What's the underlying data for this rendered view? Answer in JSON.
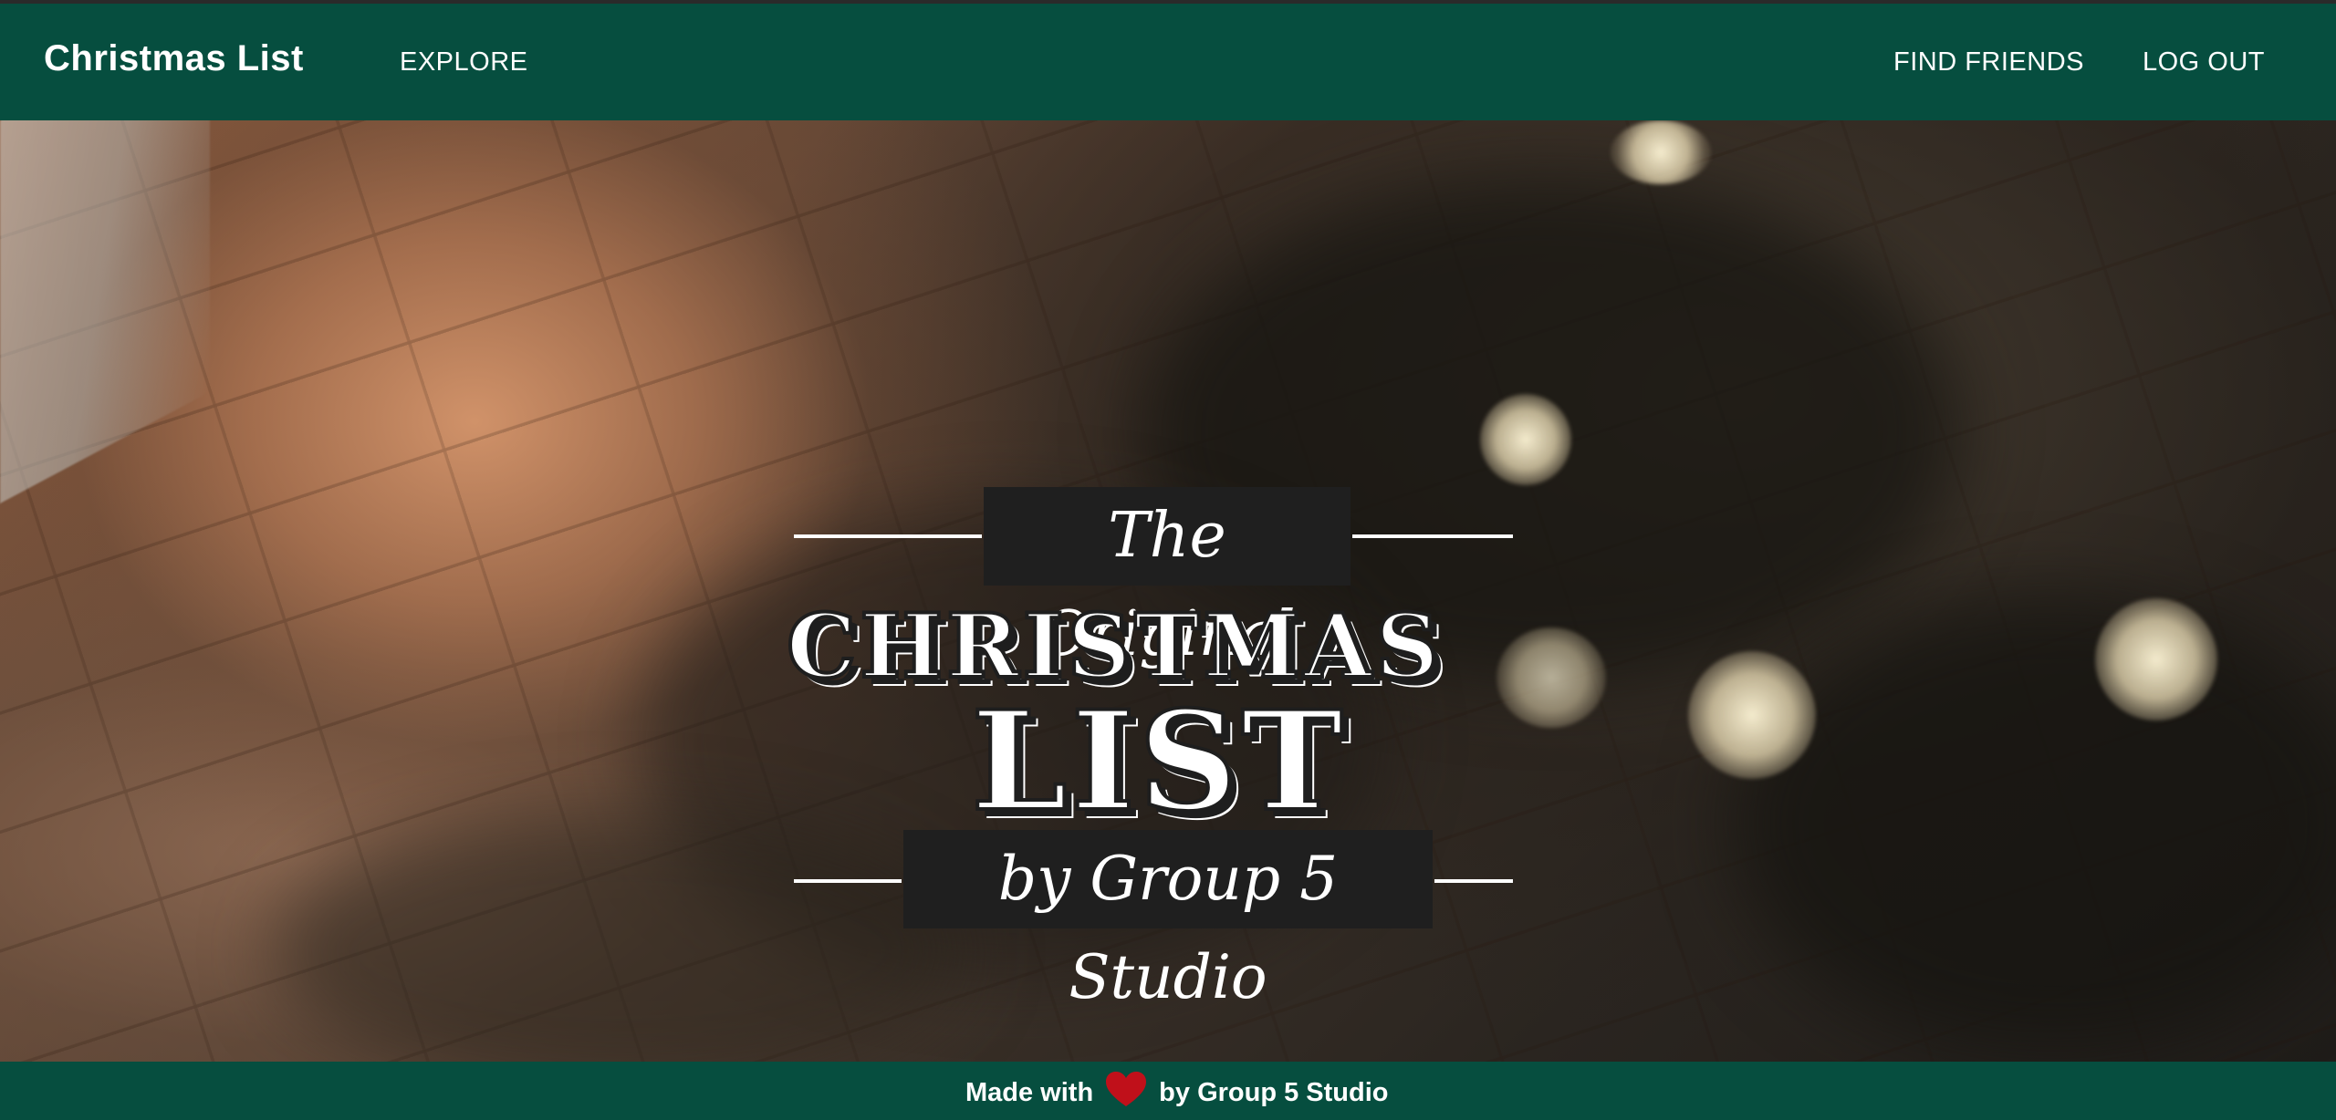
{
  "nav": {
    "brand": "Christmas List",
    "explore": "EXPLORE",
    "find_friends": "FIND FRIENDS",
    "log_out": "LOG OUT"
  },
  "hero": {
    "tagline_top": "The Original",
    "title_line1": "CHRISTMAS",
    "title_line2": "LIST",
    "tagline_bottom": "by Group 5 Studio"
  },
  "footer": {
    "made_with": "Made with",
    "heart_icon": "heart-icon",
    "by": "by Group 5 Studio"
  },
  "colors": {
    "nav_background": "#064e3f",
    "footer_background": "#064e3f",
    "heart": "#c0101a",
    "text": "#ffffff"
  }
}
